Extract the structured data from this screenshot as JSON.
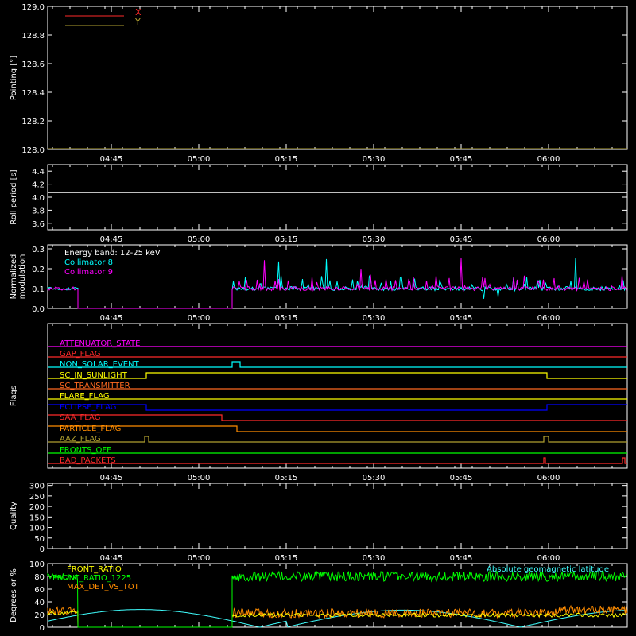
{
  "time_ticks": [
    "04:45",
    "05:00",
    "05:15",
    "05:30",
    "05:45",
    "06:00"
  ],
  "colors": {
    "axis": "#ffffff",
    "red": "#ff2a2a",
    "yellow_olive": "#b0a030",
    "cyan": "#00ffff",
    "magenta": "#ff00ff",
    "green": "#00ff00",
    "orange": "#ff8c00",
    "yellow": "#ffff00",
    "blue": "#0000ff",
    "light_cyan": "#40ffff"
  },
  "chart_data": [
    {
      "type": "line",
      "panel": "pointing",
      "ylabel": "Pointing [°]",
      "yticks": [
        "128.0",
        "128.2",
        "128.4",
        "128.6",
        "128.8",
        "129.0"
      ],
      "ylim": [
        128.0,
        129.0
      ],
      "legend": [
        {
          "name": "X",
          "color": "#ff2a2a"
        },
        {
          "name": "Y",
          "color": "#b0a030"
        }
      ],
      "series": [
        {
          "name": "X",
          "values": []
        },
        {
          "name": "Y",
          "values": [
            128.0,
            128.0
          ]
        }
      ]
    },
    {
      "type": "line",
      "panel": "roll",
      "ylabel": "Roll period [s]",
      "yticks": [
        "3.6",
        "3.8",
        "4.0",
        "4.2",
        "4.4"
      ],
      "ylim": [
        3.5,
        4.5
      ],
      "series": [
        {
          "name": "",
          "values": [
            4.07,
            4.07
          ]
        }
      ]
    },
    {
      "type": "line",
      "panel": "modulation",
      "ylabel": "Normalized modulation",
      "ylabel_lines": [
        "Normalized",
        "modulation"
      ],
      "yticks": [
        "0.0",
        "0.1",
        "0.2",
        "0.3"
      ],
      "ylim": [
        0.0,
        0.32
      ],
      "annotation": "Energy band: 12-25 keV",
      "series": [
        {
          "name": "Collimator 8",
          "color": "#00ffff"
        },
        {
          "name": "Collimator 9",
          "color": "#ff00ff"
        }
      ]
    },
    {
      "type": "line",
      "panel": "flags",
      "ylabel": "Flags",
      "flags": [
        {
          "name": "ATTENUATOR_STATE",
          "color": "#ff00ff"
        },
        {
          "name": "GAP_FLAG",
          "color": "#ff2a2a"
        },
        {
          "name": "NON_SOLAR_EVENT",
          "color": "#00ffff"
        },
        {
          "name": "SC_IN_SUNLIGHT",
          "color": "#ffff00"
        },
        {
          "name": "SC_TRANSMITTER",
          "color": "#ff6a20"
        },
        {
          "name": "FLARE_FLAG",
          "color": "#ffff00"
        },
        {
          "name": "ECLIPSE_FLAG",
          "color": "#0000ff"
        },
        {
          "name": "SAA_FLAG",
          "color": "#ff2a2a"
        },
        {
          "name": "PARTICLE_FLAG",
          "color": "#ff8c00"
        },
        {
          "name": "AAZ_FLAG",
          "color": "#b0a030"
        },
        {
          "name": "FRONTS_OFF",
          "color": "#00ff00"
        },
        {
          "name": "BAD_PACKETS",
          "color": "#ff2a2a"
        }
      ]
    },
    {
      "type": "line",
      "panel": "quality",
      "ylabel": "Quality",
      "yticks": [
        "0",
        "50",
        "100",
        "150",
        "200",
        "250",
        "300"
      ],
      "ylim": [
        0,
        310
      ]
    },
    {
      "type": "line",
      "panel": "ratios",
      "ylabel": "Degrees or %",
      "yticks": [
        "0",
        "20",
        "40",
        "60",
        "80",
        "100"
      ],
      "ylim": [
        0,
        100
      ],
      "series": [
        {
          "name": "FRONT_RATIO",
          "color": "#ffff00"
        },
        {
          "name": "FRONT_RATIO_1225",
          "color": "#00ff00"
        },
        {
          "name": "MAX_DET_VS_TOT",
          "color": "#ff8c00"
        },
        {
          "name": "Absolute geomagnetic latitude",
          "color": "#40ffff"
        }
      ]
    }
  ]
}
